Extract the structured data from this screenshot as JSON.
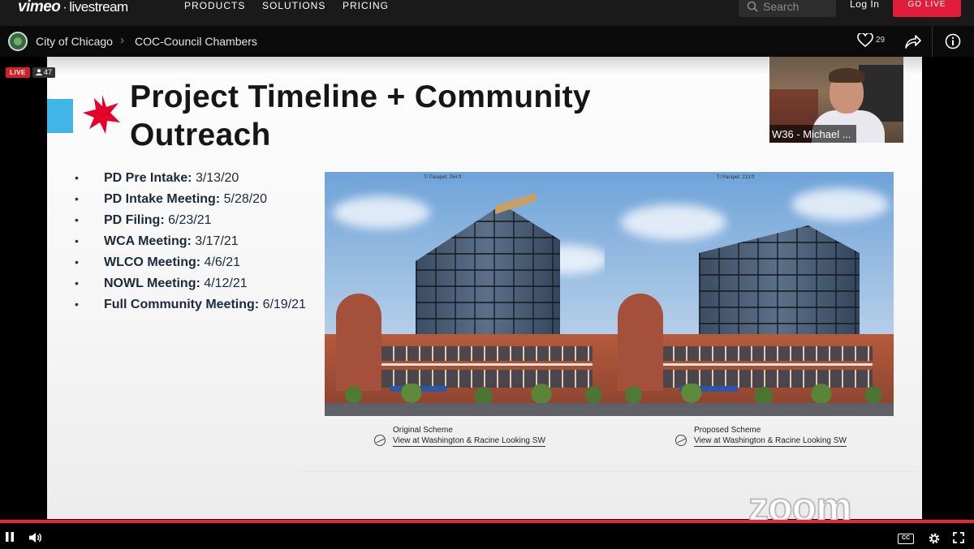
{
  "nav": {
    "logo_main": "vimeo",
    "logo_sep": "·",
    "logo_sub": "livestream",
    "links": [
      "PRODUCTS",
      "SOLUTIONS",
      "PRICING"
    ],
    "search_placeholder": "Search",
    "login_label": "Log In",
    "go_live_label": "GO LIVE"
  },
  "channel": {
    "breadcrumb": [
      "City of Chicago",
      "COC-Council Chambers"
    ],
    "likes": "29"
  },
  "player": {
    "live_label": "LIVE",
    "viewer_count": "47",
    "progress_fraction": 1.0
  },
  "slide": {
    "title": "Project Timeline + Community Outreach",
    "bullets": [
      {
        "label": "PD Pre Intake:",
        "date": "3/13/20"
      },
      {
        "label": "PD Intake Meeting:",
        "date": "5/28/20"
      },
      {
        "label": "PD Filing:",
        "date": "6/23/21"
      },
      {
        "label": "WCA Meeting:",
        "date": "3/17/21"
      },
      {
        "label": "WLCO Meeting:",
        "date": "4/6/21"
      },
      {
        "label": "NOWL Meeting:",
        "date": "4/12/21"
      },
      {
        "label": "Full Community Meeting:",
        "date": "6/19/21"
      }
    ],
    "renderings": [
      {
        "parapet": "T/ Parapet: 254 ft",
        "caption1": "Original Scheme",
        "caption2": "View at Washington & Racine Looking SW"
      },
      {
        "parapet": "T/ Parapet: 213 ft",
        "caption1": "Proposed Scheme",
        "caption2": "View at Washington & Racine Looking SW"
      }
    ],
    "watermark": "zoom"
  },
  "speaker": {
    "name": "W36 - Michael ..."
  },
  "colors": {
    "accent_red": "#e01e3c",
    "progress_red": "#f0233d",
    "chicago_blue": "#41b6e6",
    "chicago_star": "#e4002b"
  }
}
